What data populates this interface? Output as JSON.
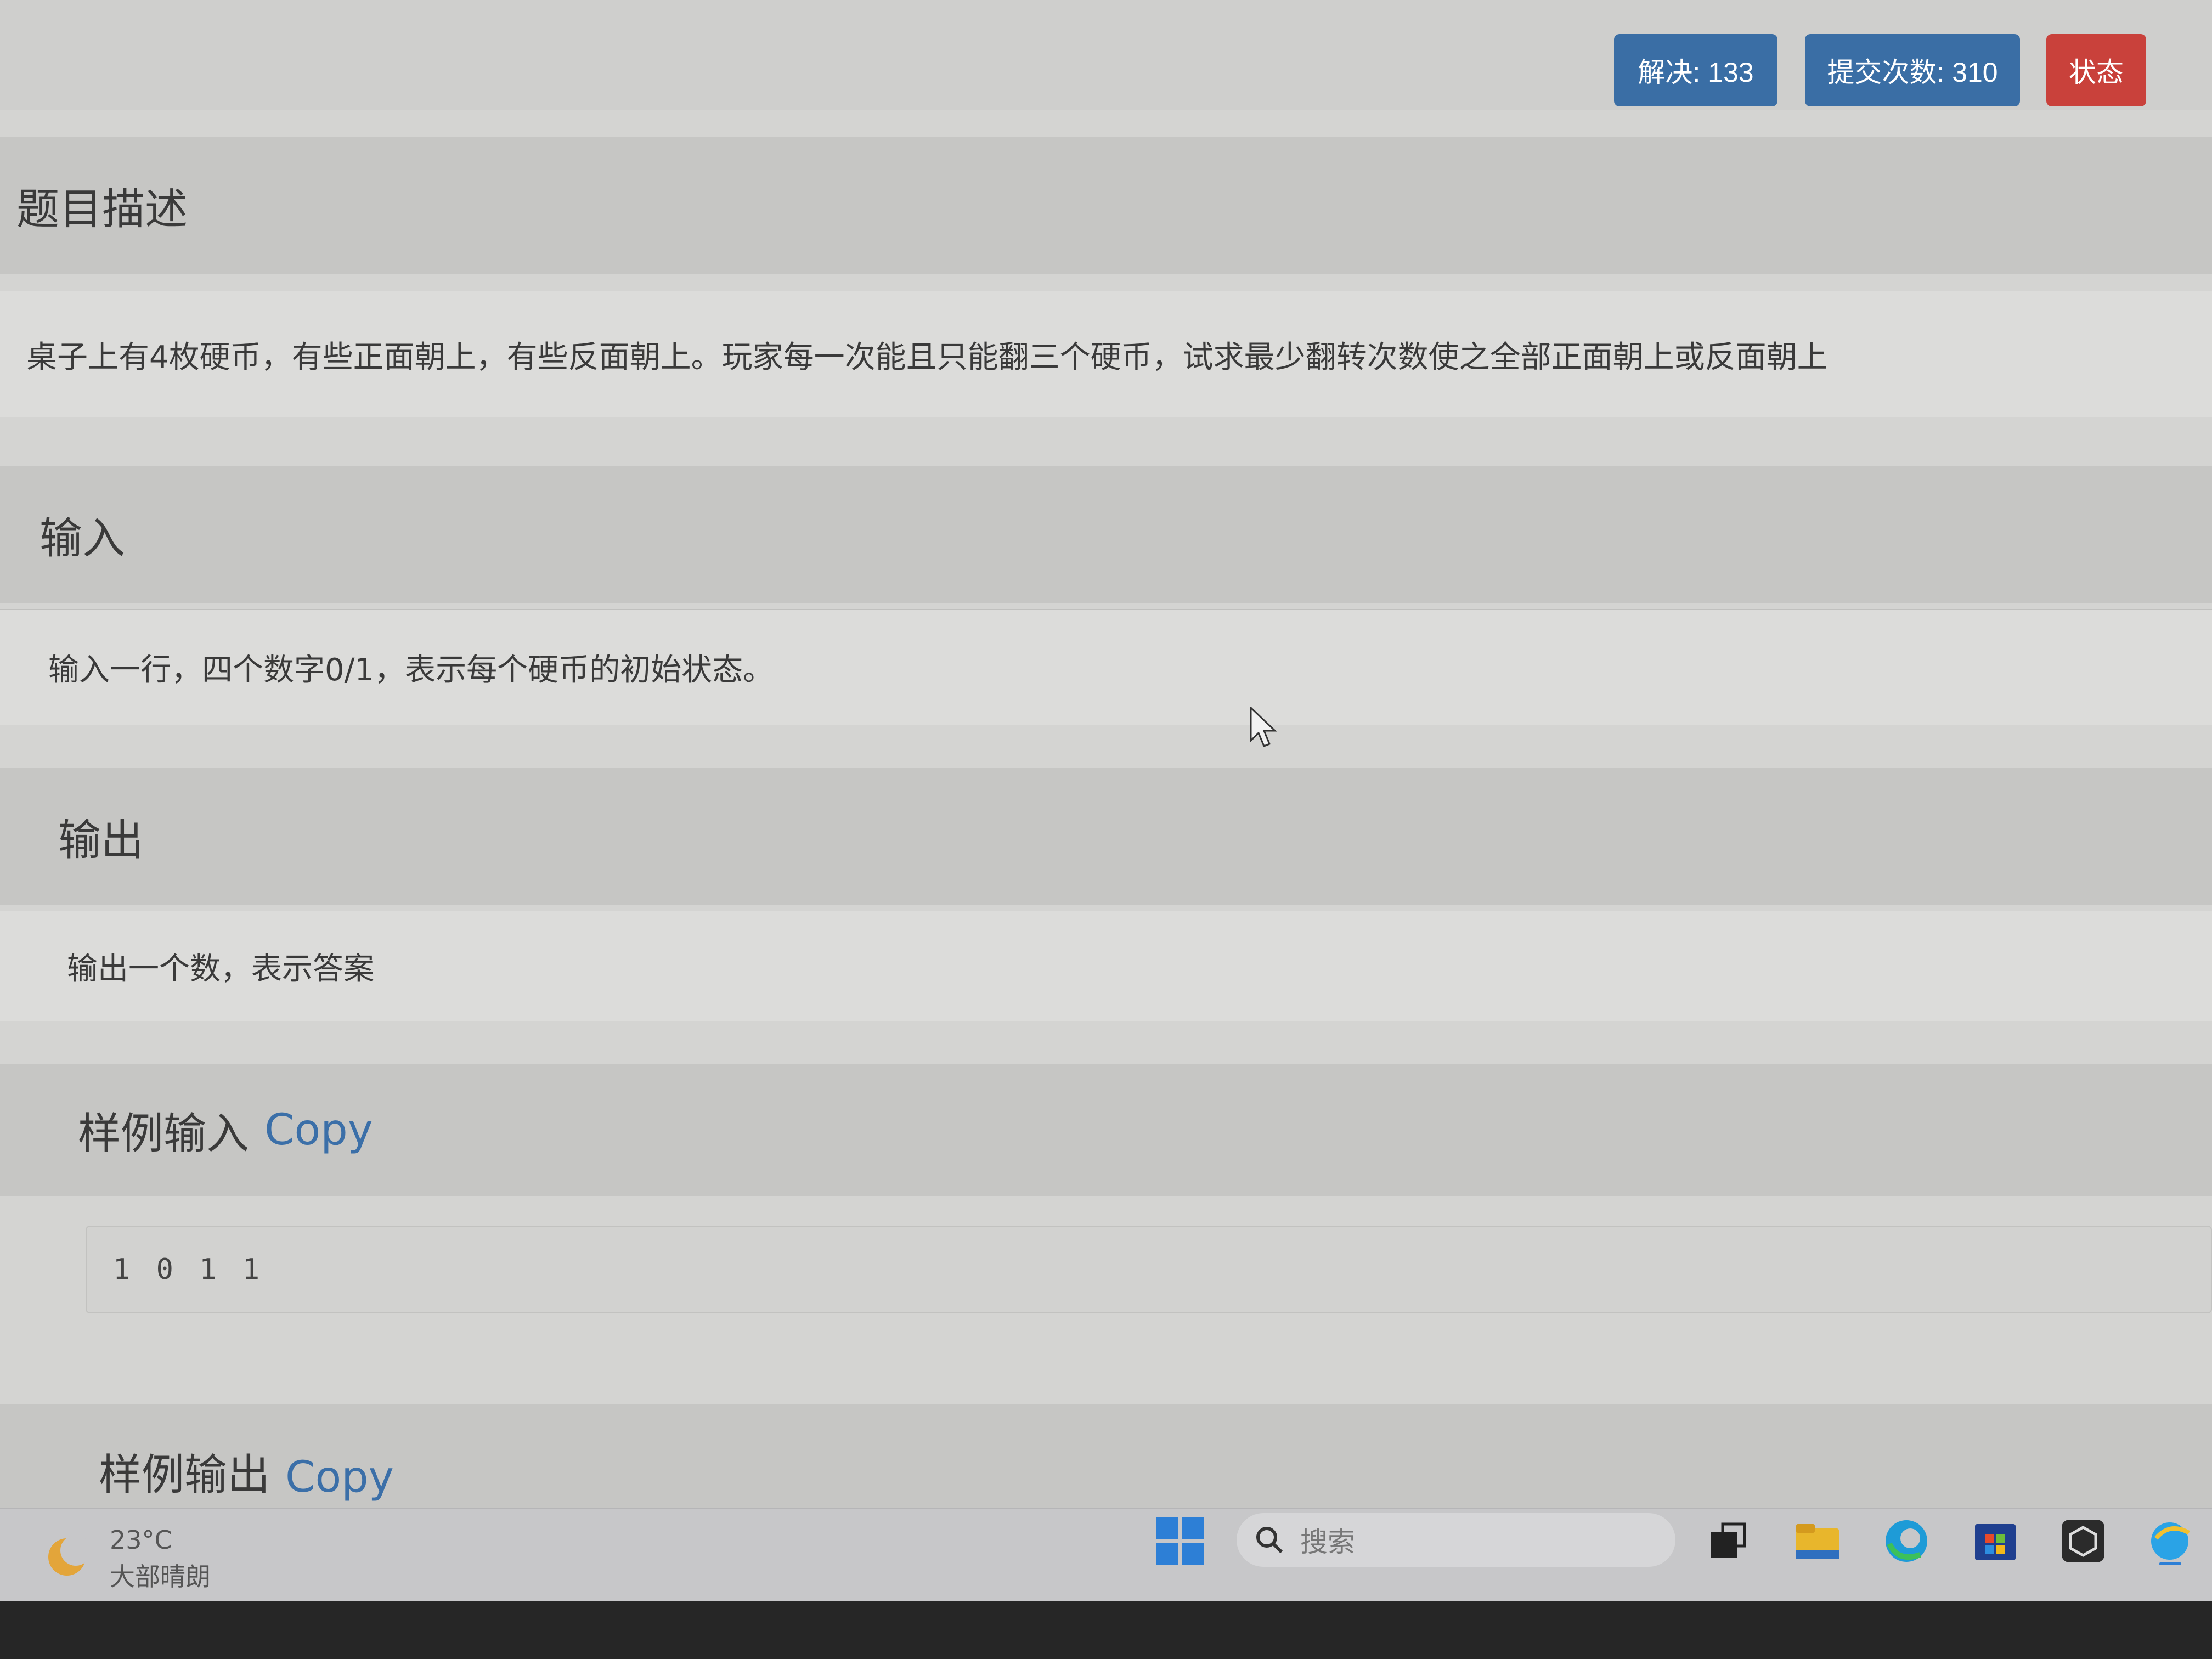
{
  "header": {
    "solved_label": "解决: 133",
    "submit_label": "提交次数: 310",
    "status_label": "状态"
  },
  "sections": {
    "description": {
      "title": "题目描述",
      "body": "桌子上有4枚硬币，有些正面朝上，有些反面朝上。玩家每一次能且只能翻三个硬币，试求最少翻转次数使之全部正面朝上或反面朝上"
    },
    "input": {
      "title": "输入",
      "body": "输入一行，四个数字0/1，表示每个硬币的初始状态。"
    },
    "output": {
      "title": "输出",
      "body": "输出一个数，表示答案"
    },
    "sample_input": {
      "title": "样例输入",
      "copy_label": "Copy",
      "value": "1 0 1 1"
    },
    "sample_output": {
      "title": "样例输出",
      "copy_label": "Copy"
    }
  },
  "taskbar": {
    "weather_temp": "23°C",
    "weather_desc": "大部晴朗",
    "search_placeholder": "搜索"
  },
  "colors": {
    "primary_button": "#3a6ea5",
    "danger_button": "#c9413b",
    "link": "#3b6fa8"
  },
  "icons": [
    "weather-icon",
    "windows-start-icon",
    "search-icon",
    "task-view-icon",
    "file-explorer-icon",
    "edge-icon",
    "store-icon",
    "app-icon",
    "ie-icon"
  ]
}
